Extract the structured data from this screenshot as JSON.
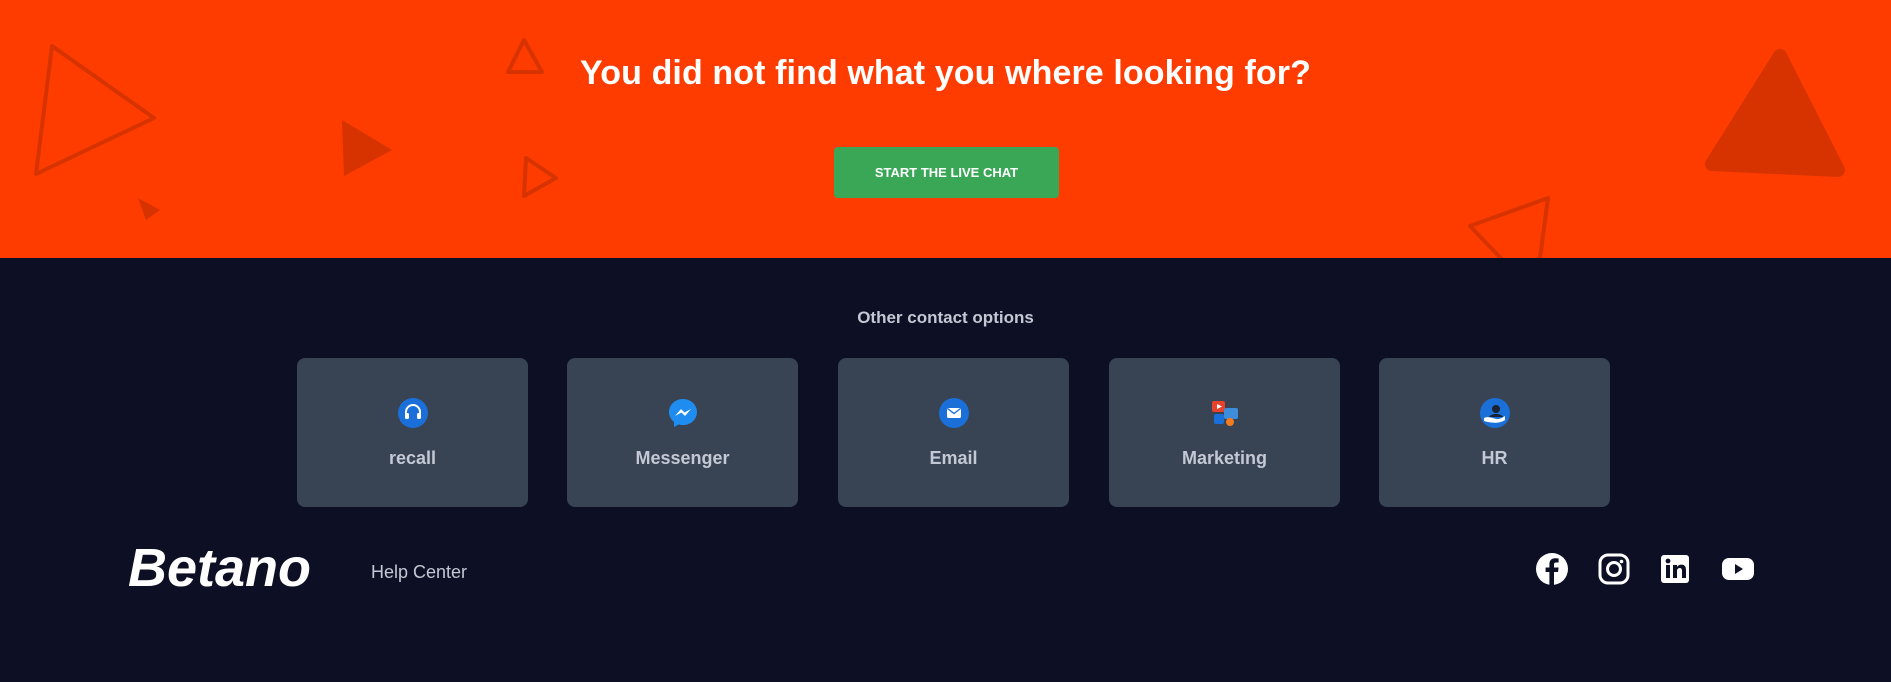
{
  "hero": {
    "title": "You did not find what you where looking for?",
    "button_label": "START THE LIVE CHAT",
    "background_color": "#ff3c00",
    "button_color": "#3aa757"
  },
  "contact": {
    "heading": "Other contact options",
    "options": [
      {
        "label": "recall",
        "icon": "headset-icon"
      },
      {
        "label": "Messenger",
        "icon": "messenger-icon"
      },
      {
        "label": "Email",
        "icon": "email-icon"
      },
      {
        "label": "Marketing",
        "icon": "marketing-icon"
      },
      {
        "label": "HR",
        "icon": "hr-icon"
      }
    ]
  },
  "footer": {
    "logo_text": "Betano",
    "help_center": "Help Center",
    "background_color": "#0d1024",
    "social": [
      {
        "name": "facebook",
        "icon": "facebook-icon"
      },
      {
        "name": "instagram",
        "icon": "instagram-icon"
      },
      {
        "name": "linkedin",
        "icon": "linkedin-icon"
      },
      {
        "name": "youtube",
        "icon": "youtube-icon"
      }
    ]
  }
}
